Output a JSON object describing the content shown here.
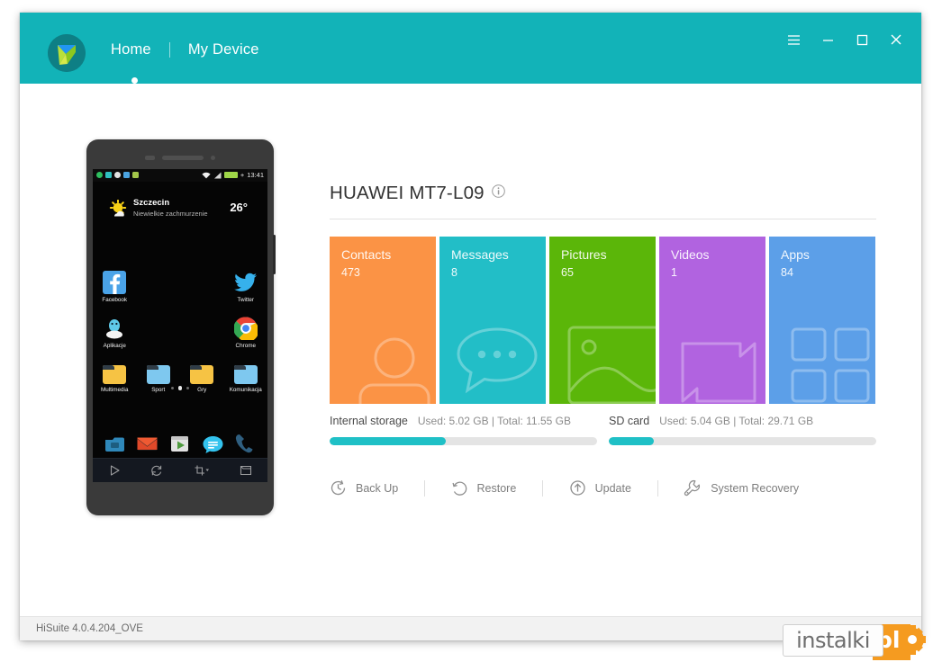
{
  "window": {
    "title_bar": {
      "nav": [
        {
          "label": "Home",
          "active": true
        },
        {
          "label": "My Device",
          "active": false
        }
      ],
      "controls": [
        {
          "name": "menu",
          "label": "☰"
        },
        {
          "name": "minimize",
          "label": "–"
        },
        {
          "name": "maximize",
          "label": "□"
        },
        {
          "name": "close",
          "label": "✕"
        }
      ],
      "accent_color": "#12b3b8"
    },
    "status_bar": {
      "version": "HiSuite 4.0.4.204_OVE"
    }
  },
  "phone": {
    "status": {
      "time": "13:41",
      "battery_label": "+",
      "notif_colors": [
        "#2ebd5e",
        "#2fbfbf",
        "#e8e8e8",
        "#4aa3e0",
        "#a3c64a"
      ]
    },
    "weather": {
      "city": "Szczecin",
      "description": "Niewielkie zachmurzenie",
      "temperature": "26°"
    },
    "apps": [
      [
        {
          "label": "Facebook",
          "icon": "facebook-icon"
        },
        {
          "label": "",
          "icon": ""
        },
        {
          "label": "",
          "icon": ""
        },
        {
          "label": "Twitter",
          "icon": "twitter-icon"
        }
      ],
      [
        {
          "label": "Aplikacje",
          "icon": "aplikacje-icon"
        },
        {
          "label": "",
          "icon": ""
        },
        {
          "label": "",
          "icon": ""
        },
        {
          "label": "Chrome",
          "icon": "chrome-icon"
        }
      ]
    ],
    "folders": [
      {
        "label": "Multimedia",
        "color": "#f6c344"
      },
      {
        "label": "Sport",
        "color": "#7ec8ef"
      },
      {
        "label": "Gry",
        "color": "#f6c344"
      },
      {
        "label": "Komunikacja",
        "color": "#7ec8ef"
      }
    ],
    "page_dots": {
      "count": 3,
      "active_index": 1
    },
    "dock": [
      {
        "name": "gallery-icon"
      },
      {
        "name": "email-icon"
      },
      {
        "name": "play-store-icon"
      },
      {
        "name": "messages-icon"
      },
      {
        "name": "phone-icon"
      }
    ],
    "toolbar": [
      {
        "name": "mirror-play-button"
      },
      {
        "name": "refresh-button"
      },
      {
        "name": "screenshot-button"
      },
      {
        "name": "folder-button"
      }
    ]
  },
  "device": {
    "name": "HUAWEI MT7-L09",
    "info_icon": "info-icon",
    "tiles": [
      {
        "label": "Contacts",
        "count": "473",
        "color": "#fb9345",
        "art": "contact"
      },
      {
        "label": "Messages",
        "count": "8",
        "color": "#22bec7",
        "art": "message"
      },
      {
        "label": "Pictures",
        "count": "65",
        "color": "#5bb609",
        "art": "picture"
      },
      {
        "label": "Videos",
        "count": "1",
        "color": "#b163e0",
        "art": "video"
      },
      {
        "label": "Apps",
        "count": "84",
        "color": "#5c9fe8",
        "art": "apps"
      }
    ],
    "storage": [
      {
        "title": "Internal storage",
        "detail": "Used: 5.02 GB | Total: 11.55 GB",
        "used_gb": 5.02,
        "total_gb": 11.55,
        "percent": 43.5,
        "fill_color": "#1fc0c6"
      },
      {
        "title": "SD card",
        "detail": "Used: 5.04 GB | Total: 29.71 GB",
        "used_gb": 5.04,
        "total_gb": 29.71,
        "percent": 17.0,
        "fill_color": "#1fc0c6"
      }
    ],
    "actions": [
      {
        "label": "Back Up",
        "icon": "backup-clock-icon"
      },
      {
        "label": "Restore",
        "icon": "restore-arrow-icon"
      },
      {
        "label": "Update",
        "icon": "update-up-arrow-icon"
      },
      {
        "label": "System Recovery",
        "icon": "wrench-icon"
      }
    ]
  },
  "watermark": {
    "text": "instalki",
    "suffix": "pl"
  }
}
